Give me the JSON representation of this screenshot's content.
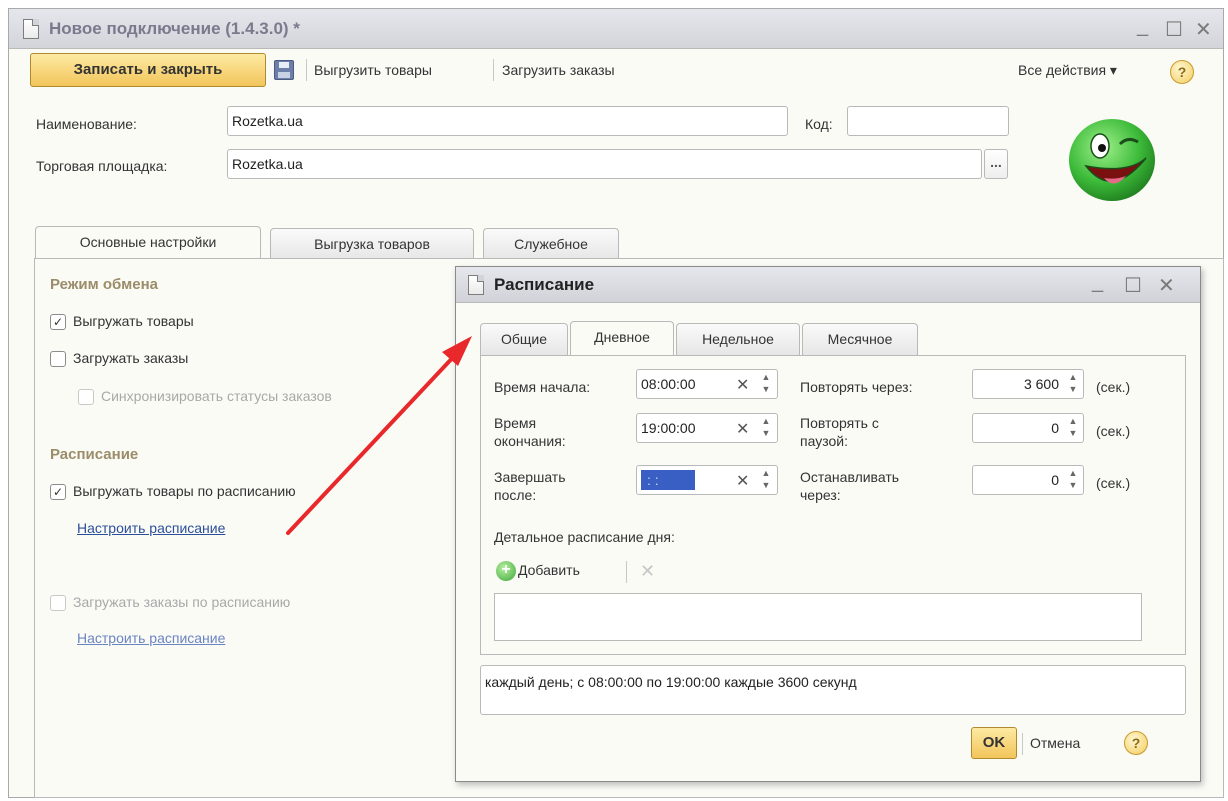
{
  "main_window": {
    "title": "Новое подключение (1.4.3.0) *",
    "controls": {
      "minimize": "_",
      "maximize": "☐",
      "close": "✕"
    }
  },
  "toolbar": {
    "save_close_label": "Записать и закрыть",
    "export_goods_label": "Выгрузить товары",
    "import_orders_label": "Загрузить заказы",
    "all_actions_label": "Все действия ▾",
    "help_label": "?"
  },
  "form": {
    "name_label": "Наименование:",
    "name_value": "Rozetka.ua",
    "code_label": "Код:",
    "code_value": "",
    "marketplace_label": "Торговая площадка:",
    "marketplace_value": "Rozetka.ua",
    "ellipsis_label": "..."
  },
  "tabs": [
    {
      "label": "Основные настройки",
      "active": true
    },
    {
      "label": "Выгрузка товаров",
      "active": false
    },
    {
      "label": "Служебное",
      "active": false
    }
  ],
  "main_tab": {
    "exchange_mode_header": "Режим обмена",
    "export_goods": {
      "label": "Выгружать товары",
      "checked": true
    },
    "import_orders": {
      "label": "Загружать заказы",
      "checked": false
    },
    "sync_statuses": {
      "label": "Синхронизировать статусы заказов",
      "checked": false,
      "disabled": true
    },
    "schedule_header": "Расписание",
    "export_by_schedule": {
      "label": "Выгружать товары по расписанию",
      "checked": true
    },
    "configure_schedule_1": "Настроить расписание",
    "import_by_schedule": {
      "label": "Загружать заказы по расписанию",
      "checked": false,
      "disabled": true
    },
    "configure_schedule_2": "Настроить расписание",
    "check_mark": "✓"
  },
  "dialog": {
    "title": "Расписание",
    "controls": {
      "minimize": "_",
      "maximize": "☐",
      "close": "✕"
    },
    "tabs": [
      {
        "label": "Общие",
        "active": false
      },
      {
        "label": "Дневное",
        "active": true
      },
      {
        "label": "Недельное",
        "active": false
      },
      {
        "label": "Месячное",
        "active": false
      }
    ],
    "start_time_label": "Время начала:",
    "start_time_value": "08:00:00",
    "end_time_label_1": "Время",
    "end_time_label_2": "окончания:",
    "end_time_value": "19:00:00",
    "finish_after_label_1": "Завершать",
    "finish_after_label_2": "после:",
    "finish_after_value": " : :",
    "repeat_every_label": "Повторять через:",
    "repeat_every_value": "3 600",
    "repeat_pause_label_1": "Повторять с",
    "repeat_pause_label_2": "паузой:",
    "repeat_pause_value": "0",
    "stop_after_label_1": "Останавливать",
    "stop_after_label_2": "через:",
    "stop_after_value": "0",
    "unit_label": "(сек.)",
    "clear_glyph": "✕",
    "spin_up": "▲",
    "spin_down": "▼",
    "detail_label": "Детальное расписание дня:",
    "add_label": "Добавить",
    "delete_glyph": "✕",
    "summary": "каждый день; с 08:00:00 по 19:00:00 каждые 3600 секунд",
    "ok_label": "OK",
    "cancel_label": "Отмена",
    "help_label": "?"
  },
  "colors": {
    "accent_button": "#f2c55a",
    "link": "#2c4f9c",
    "annotation_arrow": "#e8282b",
    "smiley_green": "#3dbb3a"
  }
}
